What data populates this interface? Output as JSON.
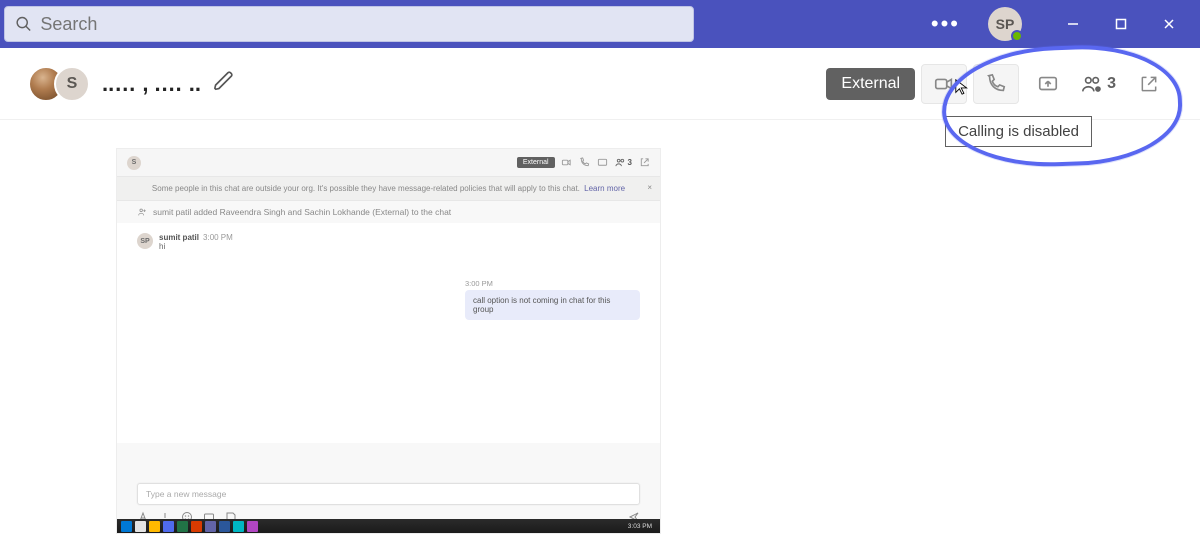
{
  "titlebar": {
    "search_placeholder": "Search",
    "avatar_initials": "SP"
  },
  "chat_header": {
    "title_initial": "S",
    "title_text": "..… , .… ..",
    "external_label": "External",
    "participant_count": "3",
    "tooltip_text": "Calling is disabled"
  },
  "mini": {
    "title_initial": "S",
    "external_label": "External",
    "participant_count": "3",
    "banner_text": "Some people in this chat are outside your org. It's possible they have message-related policies that will apply to this chat.",
    "banner_link": "Learn more",
    "system_text": "sumit patil added Raveendra Singh and Sachin Lokhande (External) to the chat",
    "msg_in": {
      "sender": "sumit patil",
      "time": "3:00 PM",
      "body": "hi"
    },
    "msg_out": {
      "time": "3:00 PM",
      "body": "call option is not coming in chat for this group"
    },
    "compose_placeholder": "Type a new message",
    "taskbar_time": "3:03 PM"
  }
}
